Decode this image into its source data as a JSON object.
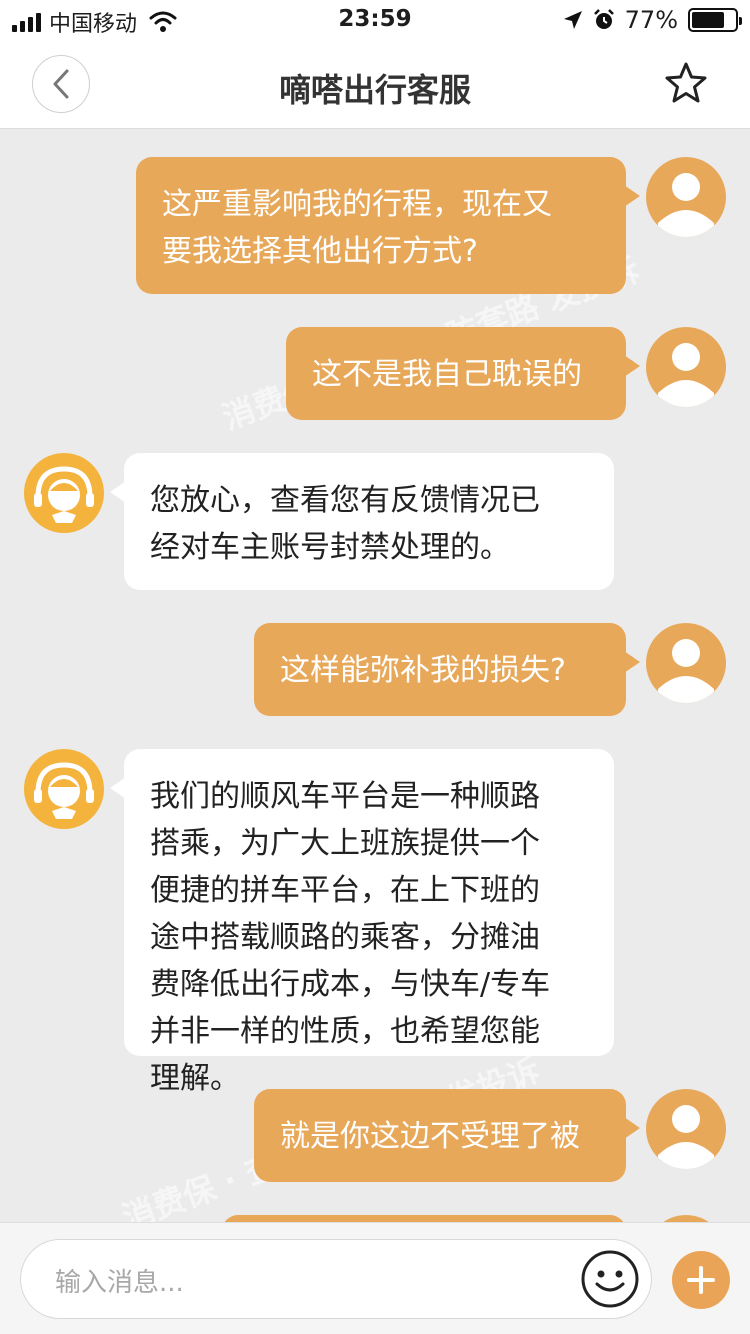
{
  "status_bar": {
    "carrier": "中国移动",
    "time": "23:59",
    "battery": "77%",
    "battery_level": 0.77
  },
  "header": {
    "title": "嘀嗒出行客服"
  },
  "watermark": {
    "brand": "消费保",
    "tagline": "查服务 防套路 发投诉"
  },
  "messages": [
    {
      "side": "right",
      "sender": "user",
      "lines": [
        "这严重影响我的行程，现在又",
        "要我选择其他出行方式?"
      ]
    },
    {
      "side": "right",
      "sender": "user",
      "lines": [
        "这不是我自己耽误的"
      ]
    },
    {
      "side": "left",
      "sender": "agent",
      "lines": [
        "您放心，查看您有反馈情况已",
        "经对车主账号封禁处理的。"
      ]
    },
    {
      "side": "right",
      "sender": "user",
      "lines": [
        "这样能弥补我的损失?"
      ]
    },
    {
      "side": "left",
      "sender": "agent",
      "lines": [
        "我们的顺风车平台是一种顺路",
        "搭乘，为广大上班族提供一个",
        "便捷的拼车平台，在上下班的",
        "途中搭载顺路的乘客，分摊油",
        "费降低出行成本，与快车/专车",
        "并非一样的性质，也希望您能",
        "理解。"
      ]
    },
    {
      "side": "right",
      "sender": "user",
      "lines": [
        "就是你这边不受理了被"
      ]
    }
  ],
  "input": {
    "placeholder": "输入消息..."
  },
  "colors": {
    "accent": "#e8a85a",
    "agent_avatar": "#f3b33d",
    "background": "#ebebeb"
  },
  "icons": {
    "back": "chevron-left-icon",
    "favorite": "star-outline-icon",
    "emoji": "smiley-icon",
    "more": "plus-icon"
  }
}
